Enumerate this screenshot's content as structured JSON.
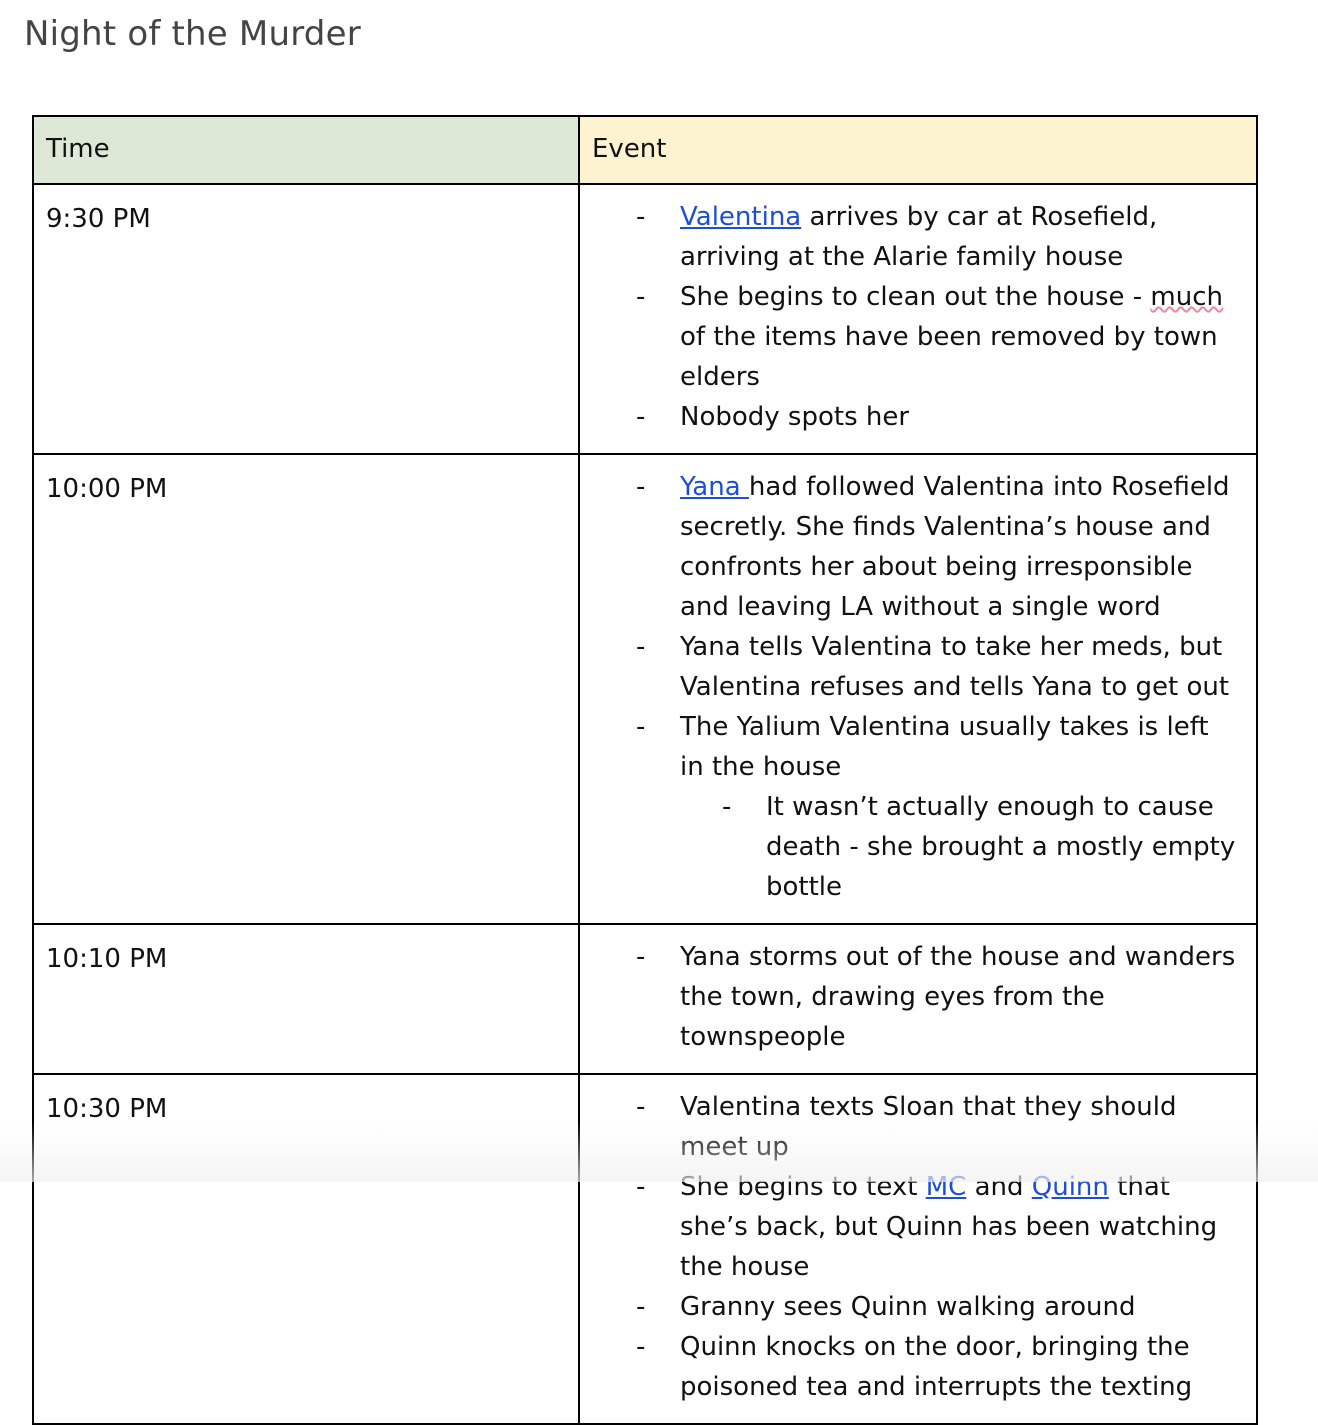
{
  "document": {
    "title": "Night of the Murder"
  },
  "table": {
    "headers": {
      "time": "Time",
      "event": "Event"
    },
    "rows": [
      {
        "time": "9:30 PM",
        "b1": {
          "link": "Valentina",
          "rest": " arrives by car at Rosefield, arriving at the Alarie family house"
        },
        "b2": {
          "pre": "She begins to clean out the house - ",
          "flagged": "much",
          "post": " of the items have been removed by town elders"
        },
        "b3": "Nobody spots her"
      },
      {
        "time": "10:00 PM",
        "b1": {
          "link": "Yana ",
          "rest": "had followed Valentina into Rosefield secretly. She finds Valentina’s house and confronts her about being irresponsible and leaving LA without a single word"
        },
        "b2": "Yana tells Valentina to take her meds, but Valentina refuses and tells Yana to get out",
        "b3": "The Yalium Valentina usually takes is left in the house",
        "sub1": "It wasn’t actually enough to cause death - she brought a mostly empty bottle"
      },
      {
        "time": "10:10 PM",
        "b1": "Yana storms out of the house and wanders the town, drawing eyes from the townspeople"
      },
      {
        "time": "10:30 PM",
        "b1": "Valentina texts Sloan that they should meet up",
        "b2": {
          "pre": "She begins to text ",
          "link1": "MC",
          "mid": " and ",
          "link2": "Quinn",
          "post": " that she’s back, but Quinn has been watching the house"
        },
        "b3": "Granny sees Quinn walking around",
        "b4": "Quinn knocks on the door, bringing the poisoned tea and interrupts the texting"
      }
    ],
    "bullet_marker": "-"
  }
}
